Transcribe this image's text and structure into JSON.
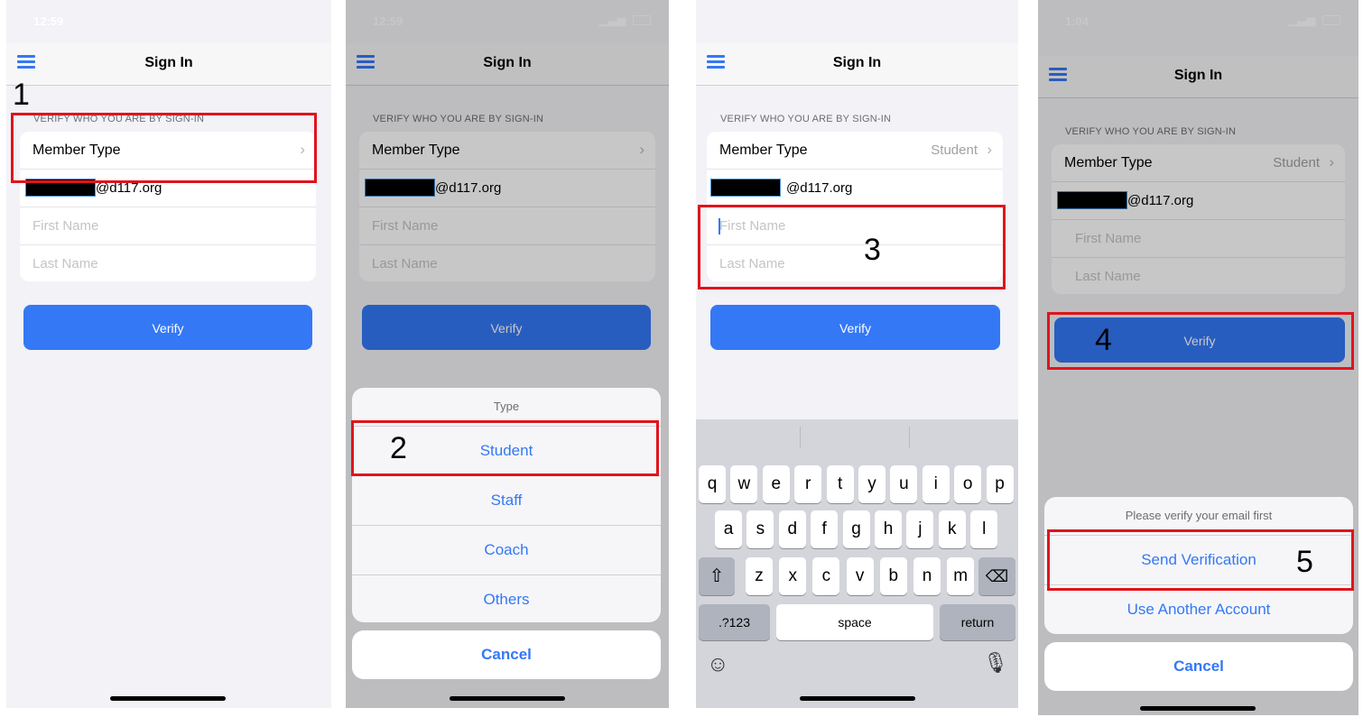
{
  "colors": {
    "accent": "#3478f6",
    "annotation": "#e0141c",
    "redaction": "#000000"
  },
  "icons": {
    "menu": "hamburger-menu-icon",
    "chevron": "chevron-right-icon",
    "shift": "shift-icon",
    "backspace": "backspace-icon",
    "emoji": "emoji-icon",
    "mic": "microphone-icon",
    "signal": "signal-icon",
    "wifi": "wifi-icon",
    "battery": "battery-icon"
  },
  "screens": [
    {
      "time": "12:59",
      "title": "Sign In",
      "section": "VERIFY WHO YOU ARE BY SIGN-IN",
      "member_type": "Member Type",
      "member_value": "",
      "email": "@d117.org",
      "first_name": "First Name",
      "last_name": "Last Name",
      "verify": "Verify",
      "step": "1"
    },
    {
      "time": "12:59",
      "title": "Sign In",
      "section": "VERIFY WHO YOU ARE BY SIGN-IN",
      "member_type": "Member Type",
      "member_value": "",
      "email": "@d117.org",
      "first_name": "First Name",
      "last_name": "Last Name",
      "verify": "Verify",
      "step": "2",
      "sheet": {
        "title": "Type",
        "options": [
          "Student",
          "Staff",
          "Coach",
          "Others"
        ],
        "cancel": "Cancel"
      }
    },
    {
      "time": "",
      "title": "Sign In",
      "section": "VERIFY WHO YOU ARE BY SIGN-IN",
      "member_type": "Member Type",
      "member_value": "Student",
      "email": "@d117.org",
      "first_name": "First Name",
      "last_name": "Last Name",
      "verify": "Verify",
      "step": "3",
      "keyboard": {
        "row1": [
          "q",
          "w",
          "e",
          "r",
          "t",
          "y",
          "u",
          "i",
          "o",
          "p"
        ],
        "row2": [
          "a",
          "s",
          "d",
          "f",
          "g",
          "h",
          "j",
          "k",
          "l"
        ],
        "row3": [
          "z",
          "x",
          "c",
          "v",
          "b",
          "n",
          "m"
        ],
        "numbers": ".?123",
        "space": "space",
        "return": "return"
      }
    },
    {
      "time": "1:04",
      "title": "Sign In",
      "section": "VERIFY WHO YOU ARE BY SIGN-IN",
      "member_type": "Member Type",
      "member_value": "Student",
      "email": "@d117.org",
      "first_name": "First Name",
      "last_name": "Last Name",
      "verify": "Verify",
      "step": "4",
      "step2": "5",
      "sheet": {
        "title": "Please verify your email first",
        "options": [
          "Send Verification",
          "Use Another Account"
        ],
        "cancel": "Cancel"
      }
    }
  ]
}
